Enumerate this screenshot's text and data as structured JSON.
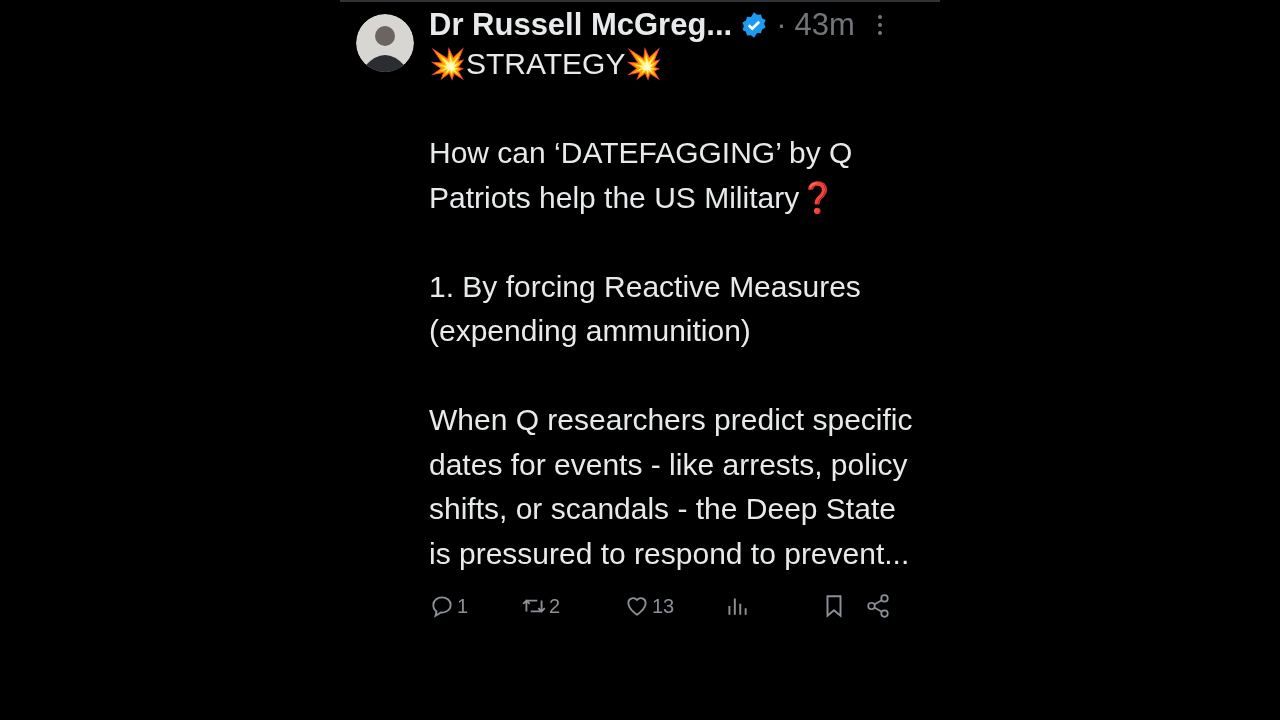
{
  "post": {
    "author": "Dr Russell McGreg...",
    "verified": true,
    "separator": "·",
    "time": "43m",
    "paragraphs": [
      "💥STRATEGY💥",
      "How can ‘DATEFAGGING’ by Q Patriots help the US Military❓",
      "1. By forcing Reactive Measures (expending ammunition)",
      "When Q researchers predict specific dates for events - like arrests, policy shifts, or scandals - the Deep State is pressured to respond to prevent..."
    ],
    "actions": [
      {
        "kind": "reply",
        "count": "1"
      },
      {
        "kind": "repost",
        "count": "2"
      },
      {
        "kind": "like",
        "count": "13"
      },
      {
        "kind": "views"
      },
      {
        "kind": "bookmark"
      },
      {
        "kind": "share"
      }
    ]
  }
}
